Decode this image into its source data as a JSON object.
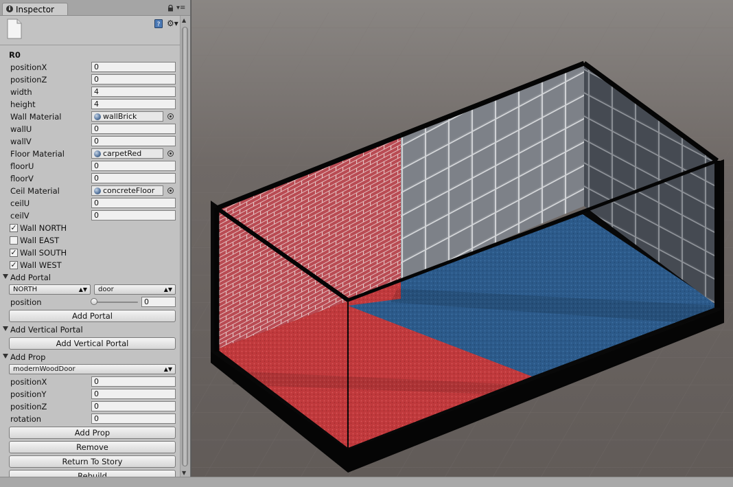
{
  "tab": {
    "title": "Inspector"
  },
  "component": {
    "name": "R0"
  },
  "fields": [
    {
      "label": "positionX",
      "value": "0"
    },
    {
      "label": "positionZ",
      "value": "0"
    },
    {
      "label": "width",
      "value": "4"
    },
    {
      "label": "height",
      "value": "4"
    },
    {
      "label": "Wall Material",
      "object": "wallBrick"
    },
    {
      "label": "wallU",
      "value": "0"
    },
    {
      "label": "wallV",
      "value": "0"
    },
    {
      "label": "Floor Material",
      "object": "carpetRed"
    },
    {
      "label": "floorU",
      "value": "0"
    },
    {
      "label": "floorV",
      "value": "0"
    },
    {
      "label": "Ceil Material",
      "object": "concreteFloor"
    },
    {
      "label": "ceilU",
      "value": "0"
    },
    {
      "label": "ceilV",
      "value": "0"
    }
  ],
  "walls": [
    {
      "label": "Wall NORTH",
      "checked": true
    },
    {
      "label": "Wall EAST",
      "checked": false
    },
    {
      "label": "Wall SOUTH",
      "checked": true
    },
    {
      "label": "Wall WEST",
      "checked": true
    }
  ],
  "add_portal": {
    "title": "Add Portal",
    "side_selected": "NORTH",
    "type_selected": "door",
    "position_label": "position",
    "position_value": "0",
    "position_fraction": 0.0,
    "button": "Add Portal"
  },
  "add_vertical_portal": {
    "title": "Add Vertical Portal",
    "button": "Add Vertical Portal"
  },
  "add_prop": {
    "title": "Add Prop",
    "prop_selected": "modernWoodDoor",
    "fields": [
      {
        "label": "positionX",
        "value": "0"
      },
      {
        "label": "positionY",
        "value": "0"
      },
      {
        "label": "positionZ",
        "value": "0"
      },
      {
        "label": "rotation",
        "value": "0"
      }
    ],
    "button": "Add Prop"
  },
  "actions": {
    "remove": "Remove",
    "return_to_story": "Return To Story",
    "rebuild": "Rebuild"
  },
  "colors": {
    "scene_bg": "#6b6360",
    "carpet_red": "#c0393c",
    "carpet_blue": "#2c5a8a",
    "brick": "#b8484e",
    "tile": "#8c8f94"
  }
}
